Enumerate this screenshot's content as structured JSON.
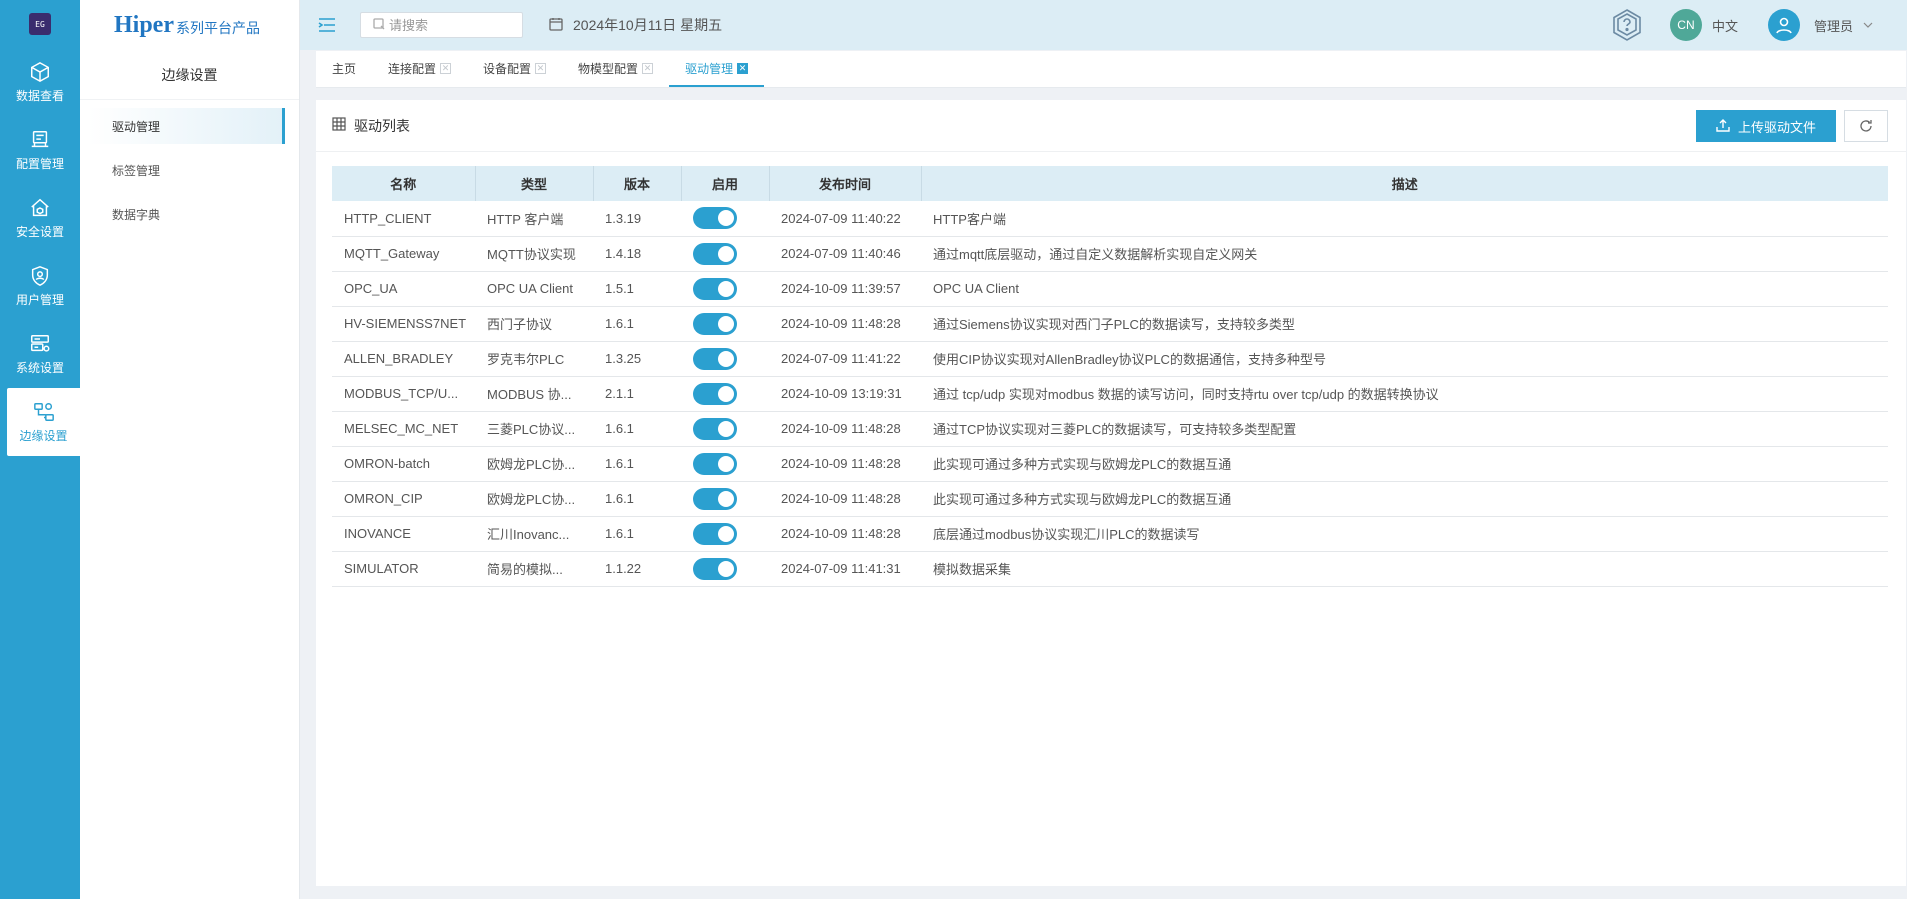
{
  "rail": {
    "logo_text": "EG",
    "items": [
      {
        "label": "数据查看",
        "icon": "cube-icon"
      },
      {
        "label": "配置管理",
        "icon": "config-icon"
      },
      {
        "label": "安全设置",
        "icon": "shield-home-icon"
      },
      {
        "label": "用户管理",
        "icon": "user-shield-icon"
      },
      {
        "label": "系统设置",
        "icon": "server-settings-icon"
      },
      {
        "label": "边缘设置",
        "icon": "edge-network-icon",
        "active": true
      }
    ]
  },
  "brand": {
    "main": "Hiper",
    "sub": "系列平台产品"
  },
  "subnav": {
    "title": "边缘设置",
    "items": [
      {
        "label": "驱动管理",
        "active": true
      },
      {
        "label": "标签管理"
      },
      {
        "label": "数据字典"
      }
    ]
  },
  "header": {
    "search_placeholder": "请搜索",
    "date": "2024年10月11日 星期五",
    "lang_badge": "CN",
    "lang_label": "中文",
    "user_name": "管理员"
  },
  "tabs": [
    {
      "label": "主页",
      "closable": false
    },
    {
      "label": "连接配置",
      "closable": true
    },
    {
      "label": "设备配置",
      "closable": true
    },
    {
      "label": "物模型配置",
      "closable": true
    },
    {
      "label": "驱动管理",
      "closable": true,
      "active": true
    }
  ],
  "panel": {
    "title": "驱动列表",
    "upload_label": "上传驱动文件"
  },
  "table": {
    "headers": [
      "名称",
      "类型",
      "版本",
      "启用",
      "发布时间",
      "描述"
    ],
    "rows": [
      {
        "name": "HTTP_CLIENT",
        "type": "HTTP 客户端",
        "version": "1.3.19",
        "enabled": true,
        "time": "2024-07-09 11:40:22",
        "desc": "HTTP客户端"
      },
      {
        "name": "MQTT_Gateway",
        "type": "MQTT协议实现",
        "version": "1.4.18",
        "enabled": true,
        "time": "2024-07-09 11:40:46",
        "desc": "通过mqtt底层驱动，通过自定义数据解析实现自定义网关"
      },
      {
        "name": "OPC_UA",
        "type": "OPC UA Client",
        "version": "1.5.1",
        "enabled": true,
        "time": "2024-10-09 11:39:57",
        "desc": "OPC UA Client"
      },
      {
        "name": "HV-SIEMENSS7NET",
        "type": "西门子协议",
        "version": "1.6.1",
        "enabled": true,
        "time": "2024-10-09 11:48:28",
        "desc": "通过Siemens协议实现对西门子PLC的数据读写，支持较多类型"
      },
      {
        "name": "ALLEN_BRADLEY",
        "type": "罗克韦尔PLC",
        "version": "1.3.25",
        "enabled": true,
        "time": "2024-07-09 11:41:22",
        "desc": "使用CIP协议实现对AllenBradley协议PLC的数据通信，支持多种型号"
      },
      {
        "name": "MODBUS_TCP/U...",
        "type": "MODBUS 协...",
        "version": "2.1.1",
        "enabled": true,
        "time": "2024-10-09 13:19:31",
        "desc": "通过 tcp/udp 实现对modbus 数据的读写访问，同时支持rtu over tcp/udp 的数据转换协议"
      },
      {
        "name": "MELSEC_MC_NET",
        "type": "三菱PLC协议...",
        "version": "1.6.1",
        "enabled": true,
        "time": "2024-10-09 11:48:28",
        "desc": "通过TCP协议实现对三菱PLC的数据读写，可支持较多类型配置"
      },
      {
        "name": "OMRON-batch",
        "type": "欧姆龙PLC协...",
        "version": "1.6.1",
        "enabled": true,
        "time": "2024-10-09 11:48:28",
        "desc": "此实现可通过多种方式实现与欧姆龙PLC的数据互通"
      },
      {
        "name": "OMRON_CIP",
        "type": "欧姆龙PLC协...",
        "version": "1.6.1",
        "enabled": true,
        "time": "2024-10-09 11:48:28",
        "desc": "此实现可通过多种方式实现与欧姆龙PLC的数据互通"
      },
      {
        "name": "INOVANCE",
        "type": "汇川Inovanc...",
        "version": "1.6.1",
        "enabled": true,
        "time": "2024-10-09 11:48:28",
        "desc": "底层通过modbus协议实现汇川PLC的数据读写"
      },
      {
        "name": "SIMULATOR",
        "type": "简易的模拟...",
        "version": "1.1.22",
        "enabled": true,
        "time": "2024-07-09 11:41:31",
        "desc": "模拟数据采集"
      }
    ]
  },
  "colors": {
    "accent": "#2ba0d0",
    "header_bg": "#dcedf5",
    "lang_badge": "#4fa898"
  }
}
